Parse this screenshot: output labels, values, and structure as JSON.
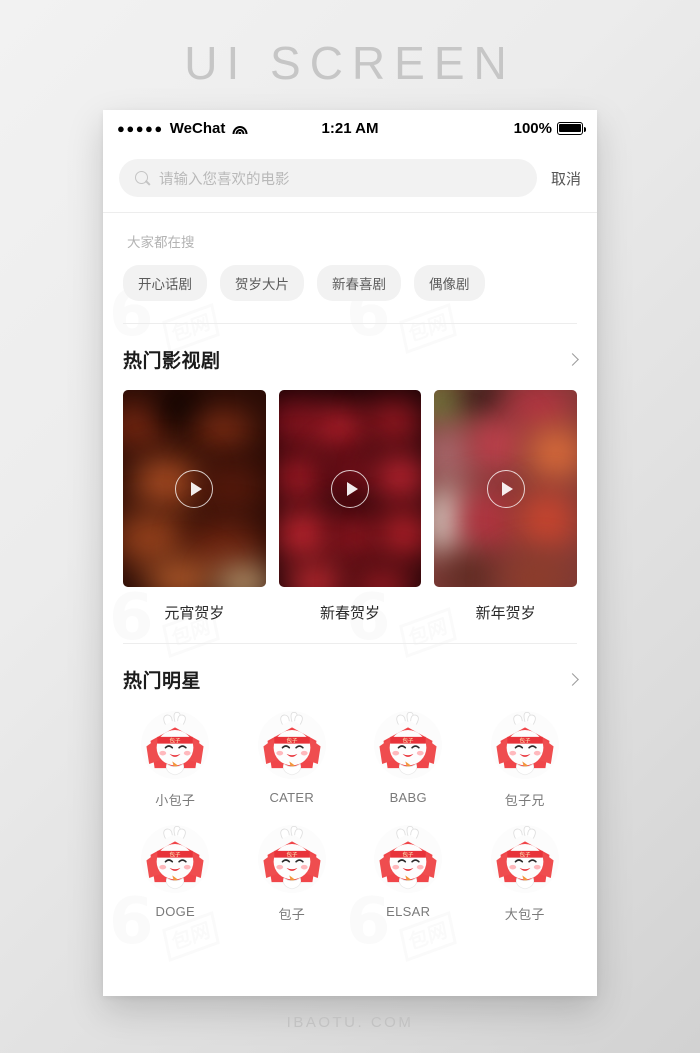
{
  "page": {
    "title": "UI SCREEN",
    "footer": "IBAOTU. COM",
    "watermark_mark": "6",
    "watermark_box": "包网"
  },
  "status_bar": {
    "signal_dots": "●●●●●",
    "carrier": "WeChat",
    "wifi_icon": "wifi-icon",
    "time": "1:21 AM",
    "battery_percent": "100%",
    "battery_icon": "battery-full-icon"
  },
  "search": {
    "icon": "search-icon",
    "placeholder": "请输入您喜欢的电影",
    "value": "",
    "cancel_label": "取消"
  },
  "hot_search": {
    "label": "大家都在搜",
    "tags": [
      "开心话剧",
      "贺岁大片",
      "新春喜剧",
      "偶像剧"
    ]
  },
  "hot_shows": {
    "title": "热门影视剧",
    "more_icon": "chevron-right-icon",
    "items": [
      {
        "caption": "元宵贺岁",
        "play_icon": "play-icon",
        "base_color": "#2a0c06"
      },
      {
        "caption": "新春贺岁",
        "play_icon": "play-icon",
        "base_color": "#1d0406"
      },
      {
        "caption": "新年贺岁",
        "play_icon": "play-icon",
        "base_color": "#7d3a36"
      }
    ]
  },
  "hot_stars": {
    "title": "热门明星",
    "more_icon": "chevron-right-icon",
    "items": [
      {
        "name": "小包子",
        "avatar": "mascot-avatar"
      },
      {
        "name": "CATER",
        "avatar": "mascot-avatar"
      },
      {
        "name": "BABG",
        "avatar": "mascot-avatar"
      },
      {
        "name": "包子兄",
        "avatar": "mascot-avatar"
      },
      {
        "name": "DOGE",
        "avatar": "mascot-avatar"
      },
      {
        "name": "包子",
        "avatar": "mascot-avatar"
      },
      {
        "name": "ELSAR",
        "avatar": "mascot-avatar"
      },
      {
        "name": "大包子",
        "avatar": "mascot-avatar"
      }
    ]
  },
  "colors": {
    "accent_red": "#e8433c",
    "chip_bg": "#f2f2f2",
    "text_primary": "#1c1c1c",
    "text_muted": "#b3b3b3"
  }
}
